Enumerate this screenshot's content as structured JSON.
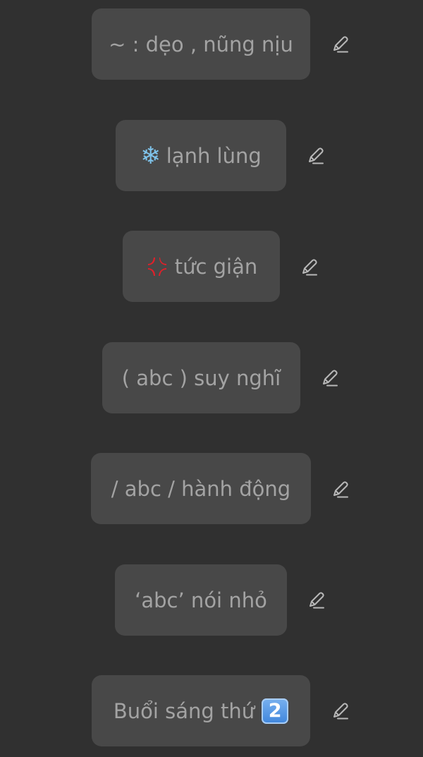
{
  "rows": [
    {
      "text": "~ : dẹo , nũng nịu"
    },
    {
      "text": "lạnh lùng",
      "emoji": "snowflake-icon"
    },
    {
      "text": "tức giận",
      "emoji": "anger-symbol-icon"
    },
    {
      "text": "( abc ) suy nghĩ"
    },
    {
      "text": "/ abc / hành động"
    },
    {
      "text": "‘abc’ nói nhỏ"
    },
    {
      "text": "Buổi sáng thứ",
      "emoji_text": "2"
    }
  ],
  "colors": {
    "background": "#303030",
    "chip": "#484848",
    "text": "#a3a3a3",
    "icon": "#b8b8b8",
    "anger": "#e0202a",
    "snowflake": "#7fc4ec",
    "keycap": "#4f93e4"
  }
}
